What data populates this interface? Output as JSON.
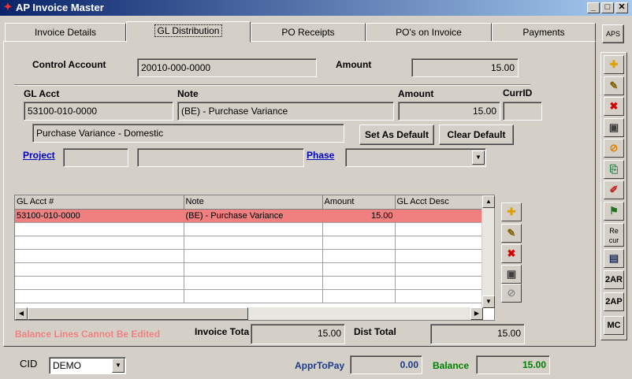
{
  "window": {
    "title": "AP Invoice Master",
    "min": "_",
    "max": "□",
    "close": "✕"
  },
  "tabs": [
    {
      "label": "Invoice Details"
    },
    {
      "label": "GL Distribution"
    },
    {
      "label": "PO Receipts"
    },
    {
      "label": "PO's on Invoice"
    },
    {
      "label": "Payments"
    }
  ],
  "aps_button": "APS",
  "control": {
    "account_label": "Control Account",
    "account_value": "20010-000-0000",
    "amount_label": "Amount",
    "amount_value": "15.00"
  },
  "detail": {
    "gl_acct_label": "GL Acct",
    "gl_acct_value": "53100-010-0000",
    "note_label": "Note",
    "note_value": "(BE) - Purchase Variance",
    "amount_label": "Amount",
    "amount_value": "15.00",
    "currid_label": "CurrID",
    "currid_value": "",
    "desc_value": "Purchase Variance - Domestic",
    "set_default": "Set As Default",
    "clear_default": "Clear Default",
    "project_label": "Project",
    "phase_label": "Phase"
  },
  "grid": {
    "columns": [
      "GL Acct #",
      "Note",
      "Amount",
      "GL Acct Desc"
    ],
    "rows": [
      [
        "53100-010-0000",
        "(BE) - Purchase Variance",
        "15.00",
        ""
      ]
    ]
  },
  "footer": {
    "warning": "Balance Lines Cannot Be Edited",
    "invoice_total_label": "Invoice Tota",
    "invoice_total_value": "15.00",
    "dist_total_label": "Dist Total",
    "dist_total_value": "15.00"
  },
  "status": {
    "cid_label": "CID",
    "cid_value": "DEMO",
    "appr_label": "ApprToPay",
    "appr_value": "0.00",
    "balance_label": "Balance",
    "balance_value": "15.00"
  },
  "right_toolbar": {
    "recur_label": "Re cur",
    "b2ar": "2AR",
    "b2ap": "2AP",
    "mc": "MC"
  },
  "colors": {
    "highlight_row": "#f08080",
    "warning": "#f08080",
    "link": "#0000c0",
    "appr": "#1a3a8a",
    "balance": "#008000"
  }
}
